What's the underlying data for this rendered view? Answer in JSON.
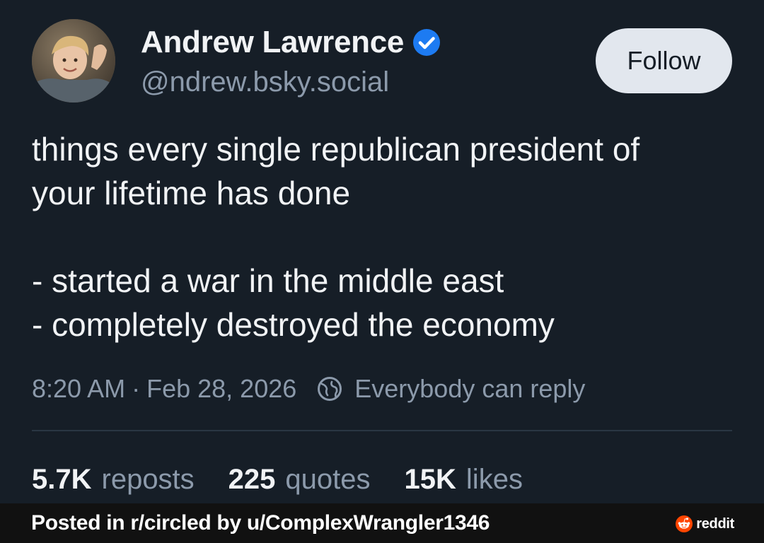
{
  "author": {
    "display_name": "Andrew Lawrence",
    "handle": "@ndrew.bsky.social",
    "verified": true
  },
  "follow_button": {
    "label": "Follow"
  },
  "post": {
    "lines": [
      "things every single republican president of",
      "your lifetime has done",
      "",
      "- started a war in the middle east",
      "- completely destroyed the economy"
    ],
    "time": "8:20 AM",
    "separator": "·",
    "date": "Feb 28, 2026",
    "reply_setting": "Everybody can reply"
  },
  "stats": {
    "reposts": {
      "count": "5.7K",
      "label": "reposts"
    },
    "quotes": {
      "count": "225",
      "label": "quotes"
    },
    "likes": {
      "count": "15K",
      "label": "likes"
    }
  },
  "footer": {
    "caption": "Posted in r/circled by u/ComplexWrangler1346",
    "brand": "reddit"
  },
  "colors": {
    "background": "#161e27",
    "accent_verified": "#1d7bf2",
    "muted_text": "#8c9aab",
    "reddit_orange": "#ff4500"
  },
  "icons": {
    "verified": "verified-badge-icon",
    "reply_setting": "globe-icon",
    "brand": "reddit-snoo-icon"
  }
}
